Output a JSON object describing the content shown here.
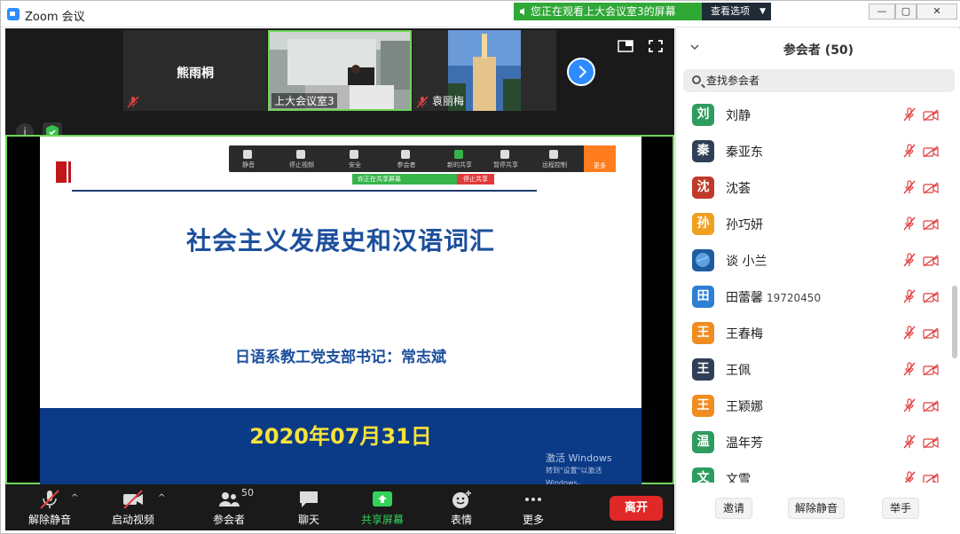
{
  "window": {
    "title": "Zoom 会议",
    "banner": "您正在观看上大会议室3的屏幕",
    "view_options": "查看选项"
  },
  "thumbnails": [
    {
      "name": "熊雨桐",
      "muted": true,
      "video": false
    },
    {
      "name": "上大会议室3",
      "muted": false,
      "video": true,
      "active": true
    },
    {
      "name": "袁丽梅",
      "muted": true,
      "video": true
    }
  ],
  "slide": {
    "title": "社会主义发展史和汉语词汇",
    "subtitle": "日语系教工党支部书记：常志斌",
    "date": "2020年07月31日",
    "watermark_line1": "激活 Windows",
    "watermark_line2": "转到\"设置\"以激活 Windows。",
    "mini_toolbar": [
      "静音",
      "停止视频",
      "安全",
      "参会者",
      "新的共享",
      "暂停共享",
      "远程控制",
      "更多"
    ],
    "mini_share_text": "你正在共享屏幕",
    "mini_stop_text": "停止共享"
  },
  "toolbar": {
    "unmute": "解除静音",
    "start_video": "启动视频",
    "participants": "参会者",
    "participants_count": "50",
    "chat": "聊天",
    "share_screen": "共享屏幕",
    "reactions": "表情",
    "more": "更多",
    "leave": "离开"
  },
  "panel": {
    "title": "参会者 (50)",
    "search_placeholder": "查找参会者",
    "participants": [
      {
        "initial": "刘",
        "name": "刘静",
        "extra": "",
        "color": "#2e9c5e"
      },
      {
        "initial": "秦",
        "name": "秦亚东",
        "extra": "",
        "color": "#2f3f57"
      },
      {
        "initial": "沈",
        "name": "沈荟",
        "extra": "",
        "color": "#c0392b"
      },
      {
        "initial": "孙",
        "name": "孙巧妍",
        "extra": "",
        "color": "#f0a020"
      },
      {
        "initial": "",
        "name": "谈 小兰",
        "extra": "",
        "color": "#1f5c9e"
      },
      {
        "initial": "田",
        "name": "田蕾馨",
        "extra": "19720450",
        "color": "#2d7fd3"
      },
      {
        "initial": "王",
        "name": "王春梅",
        "extra": "",
        "color": "#f08c20"
      },
      {
        "initial": "王",
        "name": "王佩",
        "extra": "",
        "color": "#2f3f57"
      },
      {
        "initial": "王",
        "name": "王颖娜",
        "extra": "",
        "color": "#f08c20"
      },
      {
        "initial": "温",
        "name": "温年芳",
        "extra": "",
        "color": "#2e9c5e"
      },
      {
        "initial": "文",
        "name": "文雪",
        "extra": "",
        "color": "#2e9c5e"
      }
    ],
    "footer": {
      "invite": "邀请",
      "unmute_all": "解除静音",
      "raise_hand": "举手"
    }
  },
  "colors": {
    "accent": "#2d8cff",
    "share_green": "#2fa836",
    "leave_red": "#e02828",
    "muted_red": "#e04040"
  }
}
